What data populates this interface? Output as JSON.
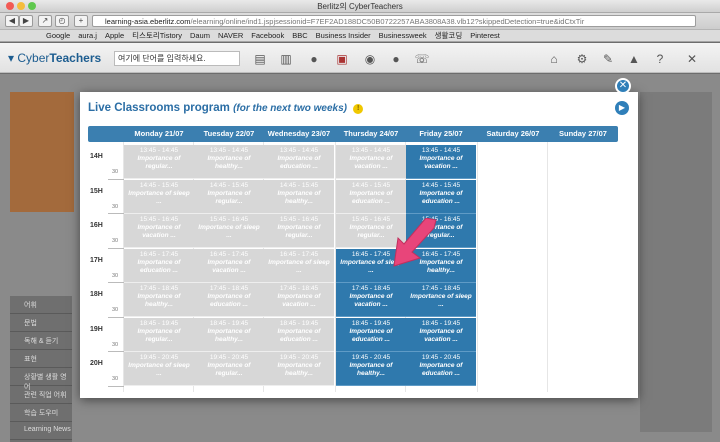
{
  "browser": {
    "window_title": "Berlitz의 CyberTeachers",
    "url_domain": "learning-asia.eberlitz.com",
    "url_rest": "/elearning/online/ind1.jspjsessionid=F7EF2AD188DC50B0722257ABA3808A38.vlb12?skippedDetection=true&idCtxTir",
    "bookmarks": [
      "Google",
      "aura.j",
      "Apple",
      "티스토리Tistory",
      "Daum",
      "NAVER",
      "Facebook",
      "BBC",
      "Business Insider",
      "Businessweek",
      "생활코딩",
      "Pinterest"
    ]
  },
  "site": {
    "logo_light": "Cyber",
    "logo_bold": "Teachers",
    "search_placeholder": "여기에 단어를 입력하세요."
  },
  "background": {
    "menu_items": [
      "어휘",
      "문법",
      "독해 & 듣기",
      "표현",
      "상황별 생활 영어",
      "관련 직업 어휘",
      "학습 도우미",
      "Learning News"
    ]
  },
  "modal": {
    "title": "Live Classrooms program",
    "subtitle": "(for the next two weeks)",
    "close_label": "✕",
    "next_label": "▶",
    "days": [
      "Monday 21/07",
      "Tuesday 22/07",
      "Wednesday 23/07",
      "Thursday 24/07",
      "Friday 25/07",
      "Saturday 26/07",
      "Sunday 27/07"
    ],
    "hours": [
      "14H",
      "15H",
      "16H",
      "17H",
      "18H",
      "19H",
      "20H"
    ],
    "half_label": "30",
    "rows": [
      {
        "time": "13:45 - 14:45",
        "cells": [
          {
            "title": "Importance of regular...",
            "state": "past"
          },
          {
            "title": "Importance of healthy...",
            "state": "past"
          },
          {
            "title": "Importance of education ...",
            "state": "past"
          },
          {
            "title": "Importance of vacation ...",
            "state": "past"
          },
          {
            "title": "Importance of vacation ...",
            "state": "available"
          }
        ]
      },
      {
        "time": "14:45 - 15:45",
        "cells": [
          {
            "title": "Importance of sleep ...",
            "state": "past"
          },
          {
            "title": "Importance of regular...",
            "state": "past"
          },
          {
            "title": "Importance of healthy...",
            "state": "past"
          },
          {
            "title": "Importance of education ...",
            "state": "past"
          },
          {
            "title": "Importance of education ...",
            "state": "available"
          }
        ]
      },
      {
        "time": "15:45 - 16:45",
        "cells": [
          {
            "title": "Importance of vacation ...",
            "state": "past"
          },
          {
            "title": "Importance of sleep ...",
            "state": "past"
          },
          {
            "title": "Importance of regular...",
            "state": "past"
          },
          {
            "title": "Importance of regular...",
            "state": "past"
          },
          {
            "title": "Importance of regular...",
            "state": "available"
          }
        ]
      },
      {
        "time": "16:45 - 17:45",
        "cells": [
          {
            "title": "Importance of education ...",
            "state": "past"
          },
          {
            "title": "Importance of vacation ...",
            "state": "past"
          },
          {
            "title": "Importance of sleep ...",
            "state": "past"
          },
          {
            "title": "Importance of sleep ...",
            "state": "available"
          },
          {
            "title": "Importance of healthy...",
            "state": "available"
          }
        ]
      },
      {
        "time": "17:45 - 18:45",
        "cells": [
          {
            "title": "Importance of healthy...",
            "state": "past"
          },
          {
            "title": "Importance of education ...",
            "state": "past"
          },
          {
            "title": "Importance of vacation ...",
            "state": "past"
          },
          {
            "title": "Importance of vacation ...",
            "state": "available"
          },
          {
            "title": "Importance of sleep ...",
            "state": "available"
          }
        ]
      },
      {
        "time": "18:45 - 19:45",
        "cells": [
          {
            "title": "Importance of regular...",
            "state": "past"
          },
          {
            "title": "Importance of healthy...",
            "state": "past"
          },
          {
            "title": "Importance of education ...",
            "state": "past"
          },
          {
            "title": "Importance of education ...",
            "state": "available"
          },
          {
            "title": "Importance of vacation ...",
            "state": "available"
          }
        ]
      },
      {
        "time": "19:45 - 20:45",
        "cells": [
          {
            "title": "Importance of sleep ...",
            "state": "past"
          },
          {
            "title": "Importance of regular...",
            "state": "past"
          },
          {
            "title": "Importance of healthy...",
            "state": "past"
          },
          {
            "title": "Importance of healthy...",
            "state": "available"
          },
          {
            "title": "Importance of education ...",
            "state": "available"
          }
        ]
      }
    ],
    "row_times_override": {
      "0": [
        "13:45 - 14:45",
        "13:45 - 14:45",
        "13:45 - 14:45",
        "13:45 - 14:45",
        "13:45 - 14:45"
      ],
      "1": [
        "14:45 - 15:45",
        "14:45 - 15:45",
        "14:45 - 15:45",
        "14:45 - 15:45",
        "14:45 - 15:45"
      ],
      "2": [
        "15:45 - 16:45",
        "15:45 - 16:45",
        "15:45 - 16:45",
        "15:45 - 16:45",
        "15:45 - 16:45"
      ],
      "3": [
        "16:45 - 17:45",
        "16:45 - 17:45",
        "16:45 - 17:45",
        "16:45 - 17:45",
        "16:45 - 17:45"
      ],
      "4": [
        "17:45 - 18:45",
        "17:45 - 18:45",
        "17:45 - 18:45",
        "17:45 - 18:45",
        "17:45 - 18:45"
      ],
      "5": [
        "18:45 - 19:45",
        "18:45 - 19:45",
        "18:45 - 19:45",
        "18:45 - 19:45",
        "18:45 - 19:45"
      ],
      "6": [
        "19:45 - 20:45",
        "19:45 - 20:45",
        "19:45 - 20:45",
        "19:45 - 20:45",
        "19:45 - 20:45"
      ]
    },
    "colors": {
      "accent": "#2f79ad",
      "past": "#d7d7d7",
      "pointer": "#e8457a"
    }
  }
}
